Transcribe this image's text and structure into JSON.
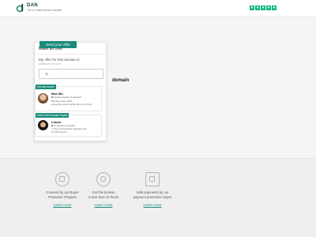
{
  "header": {
    "brand": "DAN",
    "tagline": "The #1 easy domain transfer",
    "star_count": 5,
    "star_color": "#00b67a"
  },
  "main": {
    "domain_word": "domain"
  },
  "offer": {
    "title": "Make an offer",
    "label": "My offer for this domain is:",
    "sublabel": "Minimum bid: 'xxx'",
    "currency": "€",
    "submit_label": "Send your offer"
  },
  "agents": [
    {
      "badge": "Domain broker",
      "name": "Max Mü",
      "languages": "Speaks English & Deutsch",
      "line1": "Member since 2018",
      "line2": "Generally replies within about 24 hours"
    },
    {
      "badge": "DAN.COM Domain Expert",
      "name": "Laszlo",
      "languages": "Hungarian & English",
      "line1": "\"I have successfully assisted over",
      "line2": "10,000 buyers\""
    }
  ],
  "features": [
    {
      "text1": "Covered by our Buyer",
      "text2": "Protection Program",
      "link": "Learn more",
      "icon": "shield-icon"
    },
    {
      "text1": "Get this domain",
      "text2": "in less than 24 hours",
      "link": "Learn more",
      "icon": "clock-icon"
    },
    {
      "text1": "Safe payments by our",
      "text2": "payment processor Adyen",
      "link": "Learn more",
      "icon": "lock-icon"
    }
  ],
  "colors": {
    "accent": "#1b8c7a",
    "brand": "#1b3d3a"
  }
}
